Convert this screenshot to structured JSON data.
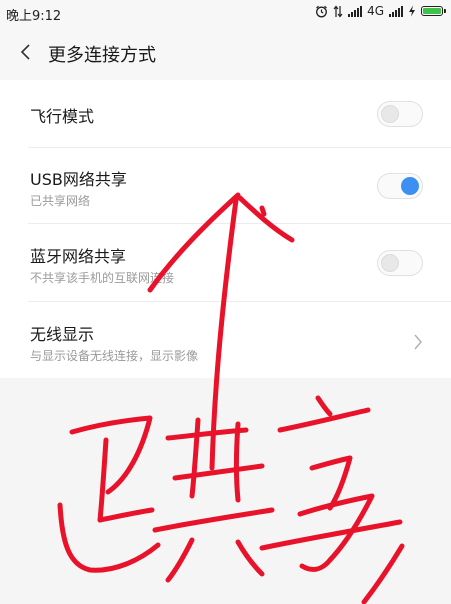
{
  "status_bar": {
    "time": "晚上9:12",
    "network": "4G",
    "icons": [
      "alarm-icon",
      "data-transfer-icon",
      "signal-icon",
      "signal-icon",
      "charging-icon",
      "battery-icon"
    ]
  },
  "header": {
    "title": "更多连接方式",
    "back_icon": "chevron-left-icon"
  },
  "settings": [
    {
      "title": "飞行模式",
      "subtitle": "",
      "control": "toggle",
      "enabled": false
    },
    {
      "title": "USB网络共享",
      "subtitle": "已共享网络",
      "control": "toggle",
      "enabled": true
    },
    {
      "title": "蓝牙网络共享",
      "subtitle": "不共享该手机的互联网连接",
      "control": "toggle",
      "enabled": false
    },
    {
      "title": "无线显示",
      "subtitle": "与显示设备无线连接，显示影像",
      "control": "chevron"
    }
  ],
  "colors": {
    "toggle_on": "#3d8ff2",
    "annotation": "#e8132b",
    "battery": "#3ec24a"
  }
}
